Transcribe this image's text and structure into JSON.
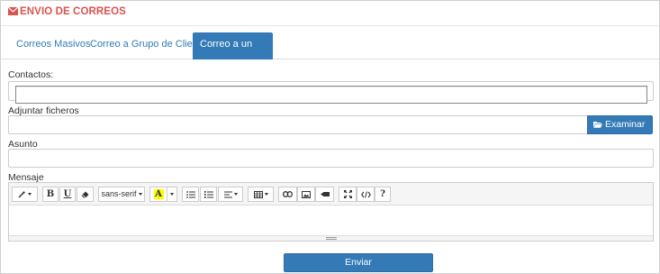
{
  "header": {
    "title": "ENVIO DE CORREOS",
    "icon": "envelope-icon",
    "color": "#d9534f"
  },
  "tabs": [
    {
      "label": "Correos Masivos",
      "active": false
    },
    {
      "label": "Correo a Grupo de Clientes",
      "active": false
    },
    {
      "label": "Correo a un cliente",
      "active": true
    }
  ],
  "form": {
    "contacts_label": "Contactos:",
    "contacts_value": "",
    "attach_label": "Adjuntar ficheros",
    "browse_label": "Examinar ...",
    "subject_label": "Asunto",
    "subject_value": "",
    "message_label": "Mensaje"
  },
  "toolbar": {
    "font_name": "sans-serif",
    "bold": "B",
    "underline": "U",
    "help": "?",
    "highlight_letter": "A",
    "highlight_color": "#ffff00"
  },
  "send_label": "Enviar",
  "accent": "#337ab7"
}
